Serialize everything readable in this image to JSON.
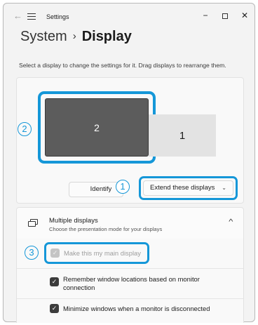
{
  "titlebar": {
    "back_icon": "back-arrow-icon",
    "menu_icon": "hamburger-menu-icon",
    "title": "Settings",
    "minimize": "−",
    "close": "✕"
  },
  "header": {
    "breadcrumb_parent": "System",
    "separator": "›",
    "current_page": "Display"
  },
  "description": "Select a display to change the settings for it. Drag displays to rearrange them.",
  "arrangement": {
    "monitors": [
      {
        "label": "2",
        "selected": true
      },
      {
        "label": "1",
        "selected": false
      }
    ],
    "identify_label": "Identify",
    "mode_select": {
      "value": "Extend these displays",
      "chevron": "⌄"
    }
  },
  "callouts": [
    "1",
    "2",
    "3"
  ],
  "multiple_displays": {
    "icon": "multiple-monitors-icon",
    "title": "Multiple displays",
    "subtitle": "Choose the presentation mode for your displays",
    "chevron": "^",
    "expanded": true,
    "options": [
      {
        "label": "Make this my main display",
        "checked": true,
        "disabled": true
      },
      {
        "label_line1": "Remember window locations based on monitor",
        "label_line2": "connection",
        "checked": true,
        "disabled": false
      },
      {
        "label": "Minimize windows when a monitor is disconnected",
        "checked": true,
        "disabled": false
      }
    ]
  },
  "colors": {
    "highlight": "#1597d8",
    "selected_monitor": "#5c5c5c",
    "unselected_monitor": "#e3e3e3",
    "checkbox": "#3c3c3c"
  }
}
